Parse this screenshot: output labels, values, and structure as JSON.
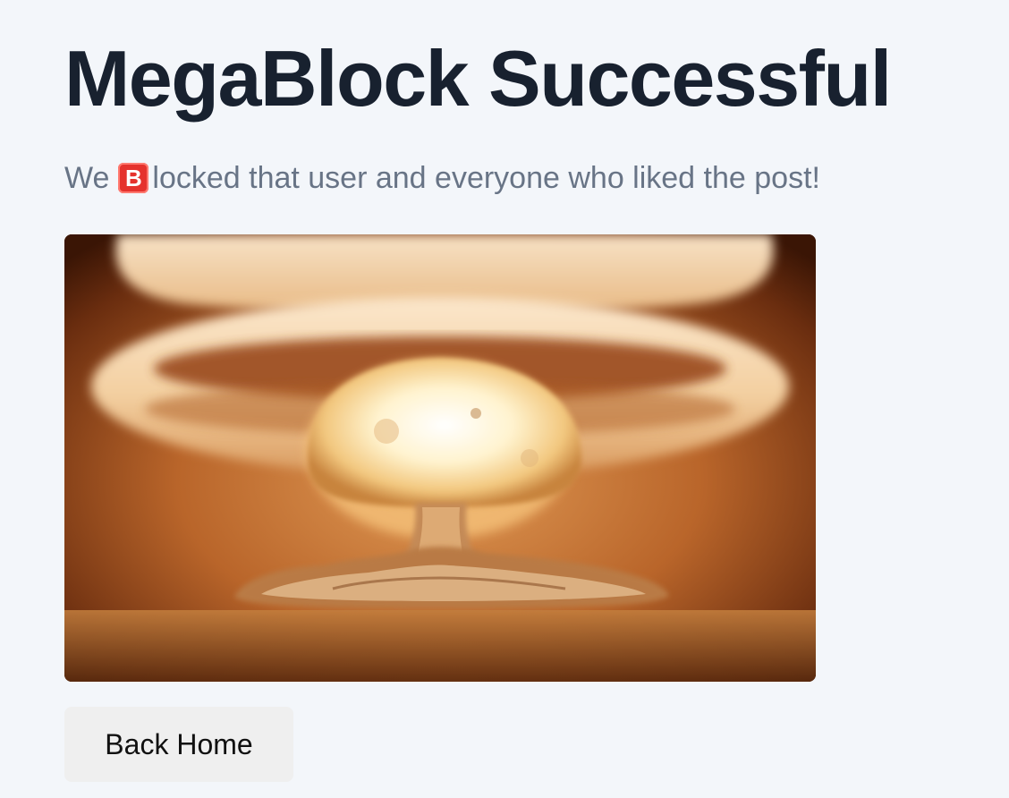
{
  "header": {
    "title": "MegaBlock Successful"
  },
  "message": {
    "prefix": "We",
    "badge_letter": "B",
    "badge_icon": "b-button-emoji",
    "suffix": "locked that user and everyone who liked the post!"
  },
  "hero_image": {
    "subject": "mushroom-cloud-explosion"
  },
  "actions": {
    "back_home_label": "Back Home"
  },
  "colors": {
    "background": "#f3f6fa",
    "title": "#18212f",
    "subtitle": "#687486",
    "badge": "#e5322d",
    "button_bg": "#efefef"
  }
}
